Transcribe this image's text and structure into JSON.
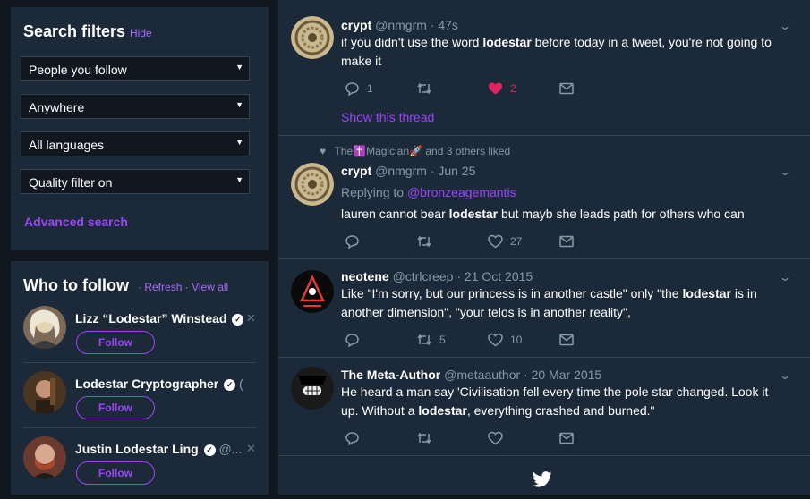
{
  "search_filters": {
    "title": "Search filters",
    "dot": "·",
    "hide": "Hide",
    "selects": [
      "People you follow",
      "Anywhere",
      "All languages",
      "Quality filter on"
    ],
    "advanced": "Advanced search"
  },
  "who_to_follow": {
    "title": "Who to follow",
    "dot": "·",
    "refresh": "Refresh",
    "view_all": "View all",
    "follow_label": "Follow",
    "users": [
      {
        "name": "Lizz “Lodestar” Winstead",
        "handle": ""
      },
      {
        "name": "Lodestar Cryptographer",
        "handle": "("
      },
      {
        "name": "Justin Lodestar Ling",
        "handle": "@..."
      }
    ]
  },
  "tweets": [
    {
      "name": "crypt",
      "meta": "@nmgrm · 47s",
      "text_a": "if you didn't use the word ",
      "keyword": "lodestar",
      "text_b": " before today in a tweet, you're not going to make it",
      "replies": "1",
      "retweets": "",
      "likes": "2",
      "show_thread": "Show this thread"
    },
    {
      "context": "The✝️Magician🚀 and 3 others liked",
      "name": "crypt",
      "meta": "@nmgrm · Jun 25",
      "replying_prefix": "Replying to ",
      "replying_to": "@bronzeagemantis",
      "text_a": "lauren cannot bear ",
      "keyword": "lodestar",
      "text_b": " but mayb she leads path for others who can",
      "replies": "",
      "retweets": "",
      "likes": "27"
    },
    {
      "name": "neotene",
      "meta": "@ctrlcreep · 21 Oct 2015",
      "text_a": "Like \"I'm sorry, but our princess is in another castle\" only \"the ",
      "keyword": "lodestar",
      "text_b": " is in another dimension\", \"your telos is in another reality\",",
      "replies": "",
      "retweets": "5",
      "likes": "10"
    },
    {
      "name": "The Meta-Author",
      "meta": "@metaauthor · 20 Mar 2015",
      "text_a": "He heard a man say 'Civilisation fell every time the pole star changed. Look it up. Without a ",
      "keyword": "lodestar",
      "text_b": ", everything crashed and burned.\"",
      "replies": "",
      "retweets": "",
      "likes": ""
    }
  ],
  "colors": {
    "accent": "#9b45fb",
    "like": "#e0245e",
    "background": "#10171e",
    "card": "#1c2938",
    "muted": "#8899a6"
  },
  "icons": [
    "reply-icon",
    "retweet-icon",
    "like-icon",
    "message-icon",
    "chevron-down-icon",
    "verified-icon",
    "close-icon",
    "twitter-bird-icon"
  ]
}
